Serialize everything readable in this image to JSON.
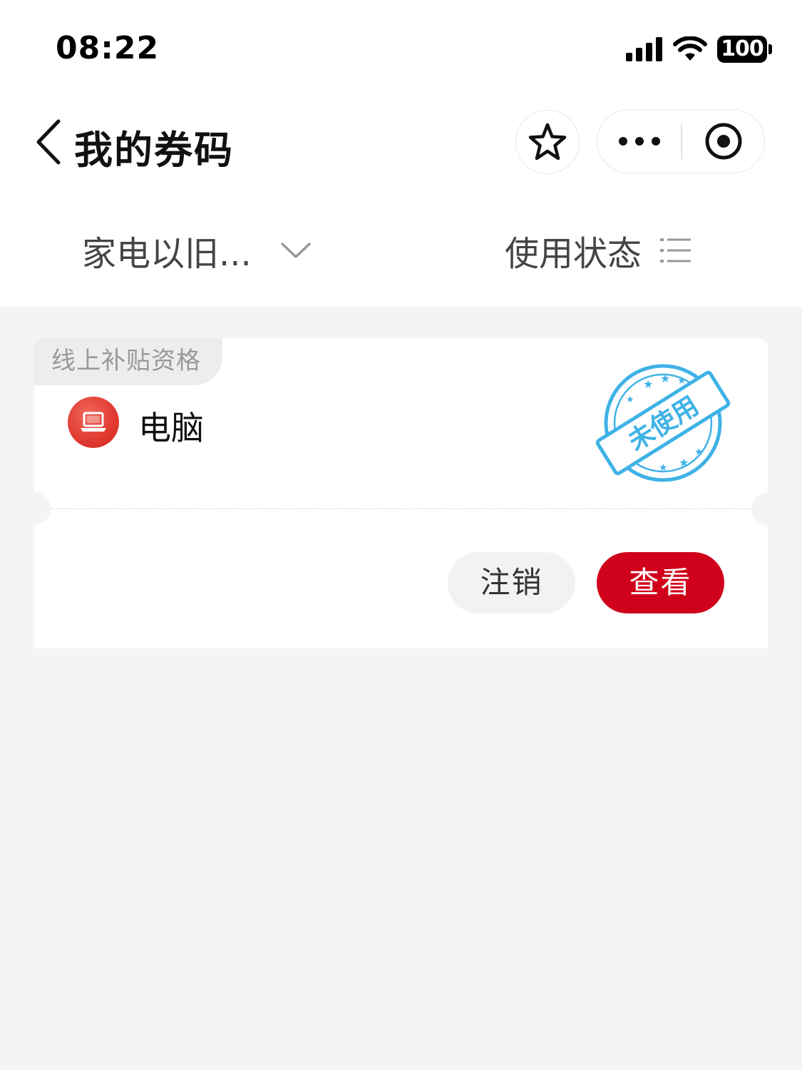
{
  "status_bar": {
    "time": "08:22",
    "battery": "100"
  },
  "nav": {
    "title": "我的券码"
  },
  "filters": {
    "category": "家电以旧...",
    "status": "使用状态"
  },
  "coupon": {
    "tag": "线上补贴资格",
    "product": "电脑",
    "stamp_text": "未使用",
    "cancel_label": "注销",
    "view_label": "查看"
  },
  "colors": {
    "accent_red": "#d0021b",
    "stamp_blue": "#3fb2e6",
    "icon_red": "#e0382f"
  }
}
